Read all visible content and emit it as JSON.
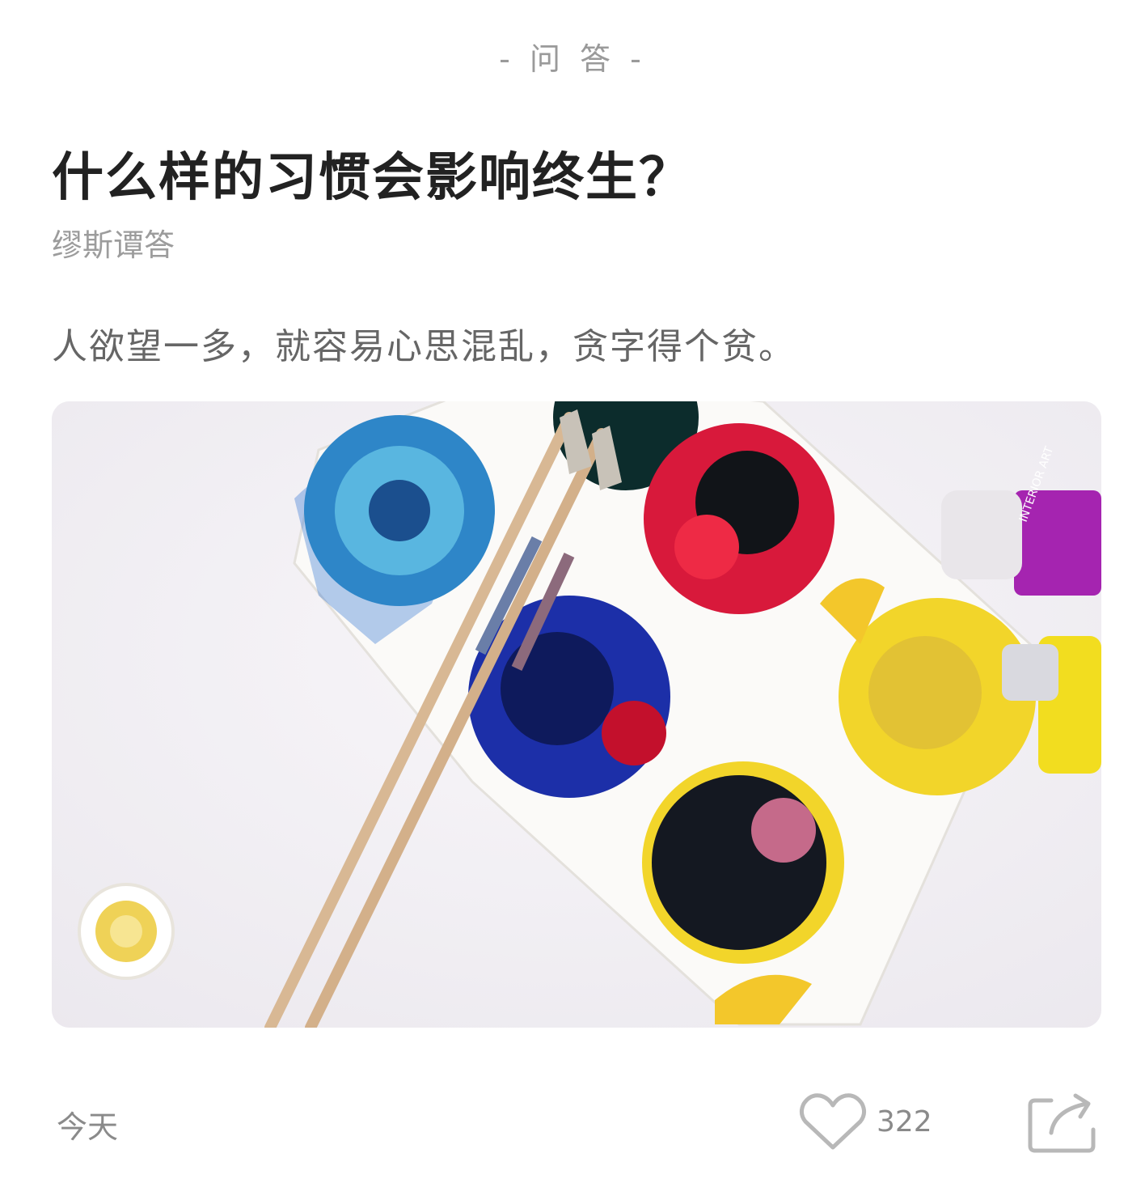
{
  "section": {
    "label": "- 问 答 -"
  },
  "article": {
    "title": "什么样的习惯会影响终生？",
    "author": "缪斯谭答",
    "excerpt": "人欲望一多，就容易心思混乱，贪字得个贫。",
    "cover_image": {
      "icon": "watercolor-palette-image",
      "tube_label": "INTERIOR ART"
    }
  },
  "footer": {
    "date": "今天",
    "like": {
      "icon": "heart-icon",
      "count": "322"
    },
    "share": {
      "icon": "share-icon"
    }
  },
  "colors": {
    "title": "#222222",
    "secondary_text": "#9c9c9c",
    "excerpt": "#666666",
    "icon": "#b8b8b8"
  }
}
